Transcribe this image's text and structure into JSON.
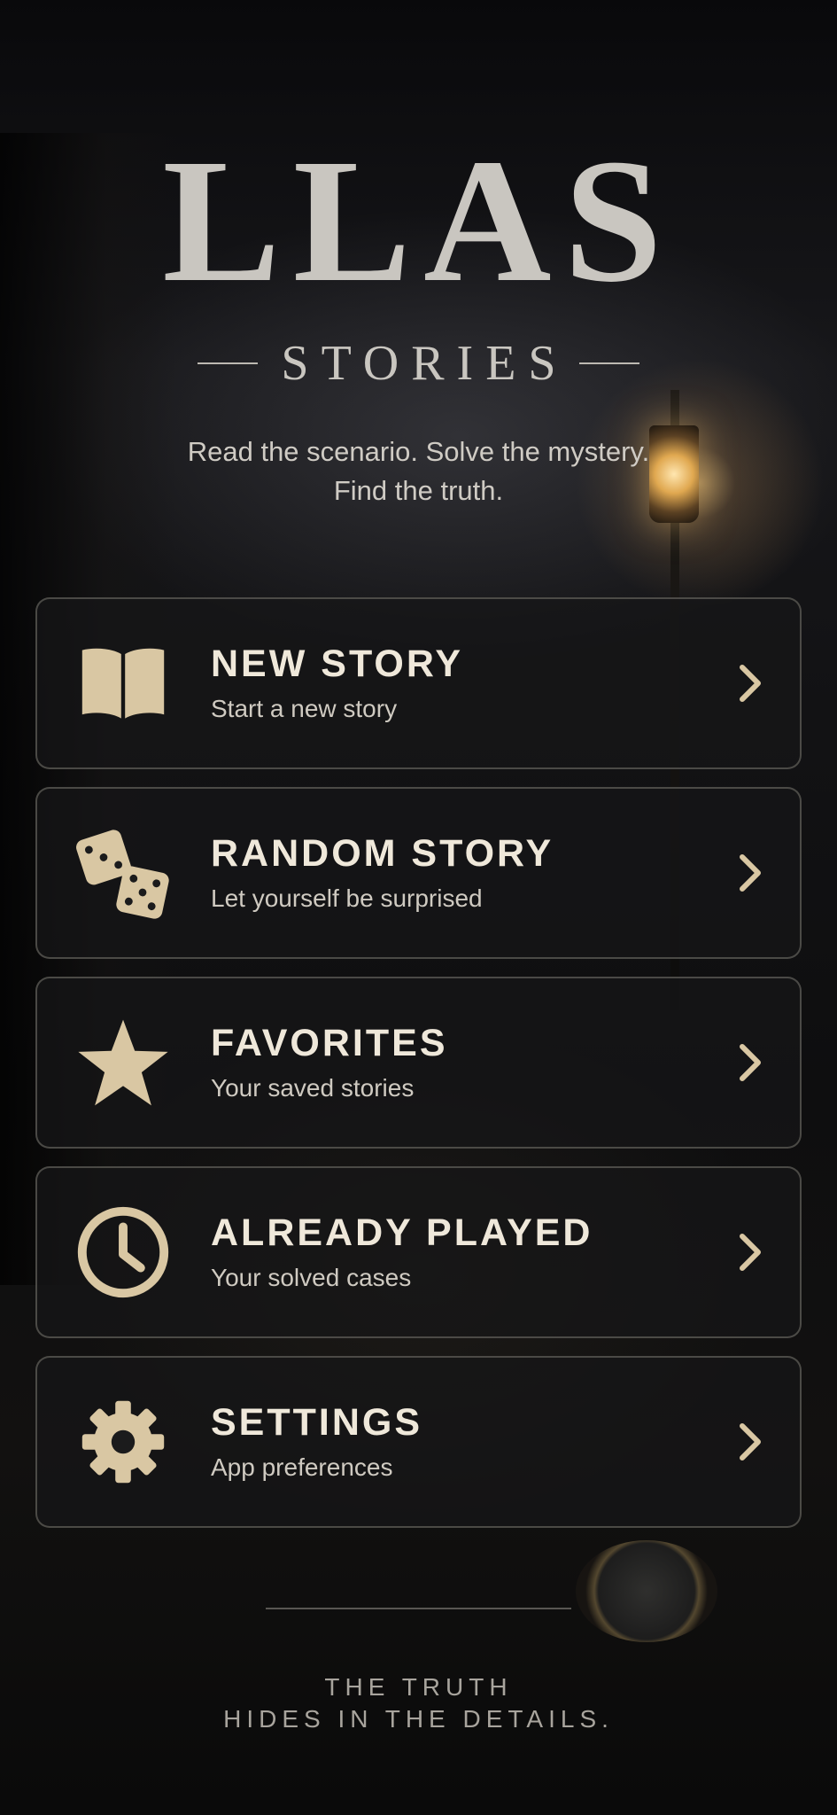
{
  "app": {
    "title": "LLAS",
    "subtitle": "STORIES",
    "tagline_line1": "Read the scenario. Solve the mystery.",
    "tagline_line2": "Find the truth."
  },
  "colors": {
    "accent": "#d9c7a3",
    "card_bg": "#161618",
    "text_primary": "#efe8da",
    "text_secondary": "#cfcac1"
  },
  "menu": [
    {
      "label": "NEW STORY",
      "description": "Start a new story",
      "icon": "open-book-icon"
    },
    {
      "label": "RANDOM STORY",
      "description": "Let yourself be surprised",
      "icon": "dice-icon"
    },
    {
      "label": "FAVORITES",
      "description": "Your saved stories",
      "icon": "star-icon"
    },
    {
      "label": "ALREADY PLAYED",
      "description": "Your solved cases",
      "icon": "clock-icon"
    },
    {
      "label": "SETTINGS",
      "description": "App preferences",
      "icon": "gear-icon"
    }
  ],
  "footer": {
    "line1": "THE TRUTH",
    "line2": "HIDES IN THE DETAILS."
  }
}
